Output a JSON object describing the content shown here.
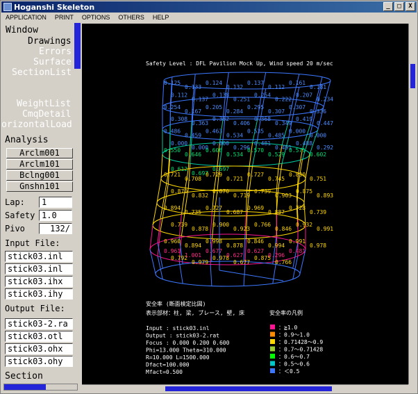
{
  "window": {
    "title": "Hoganshi Skeleton",
    "min": "_",
    "max": "□",
    "close": "X"
  },
  "menu": [
    "APPLICATION",
    "PRINT",
    "OPTIONS",
    "OTHERS",
    "HELP"
  ],
  "nav": {
    "window": "Window",
    "drawings": "Drawings",
    "errors": "Errors",
    "surface": "Surface",
    "sectionlist": "SectionList",
    "weightlist": "WeightList",
    "cmqdetail": "CmqDetail",
    "horizontalload": "orizontalLoad"
  },
  "analysis": {
    "label": "Analysis",
    "buttons": [
      "Arclm001",
      "Arclm101",
      "Bclng001",
      "Gnshn101"
    ]
  },
  "fields": {
    "lap_label": "Lap:",
    "lap": "1",
    "safety_label": "Safety",
    "safety": "1.0",
    "pivo_label": "Pivo",
    "pivo": "132/"
  },
  "input_files": {
    "label": "Input File:",
    "files": [
      "stick03.inl",
      "stick03.inl",
      "stick03.ihx",
      "stick03.ihy"
    ]
  },
  "output_files": {
    "label": "Output File:",
    "files": [
      "stick03-2.ra",
      "stick03.otl",
      "stick03.ohx",
      "stick03.ohy"
    ]
  },
  "section_label": "Section",
  "canvas": {
    "title": "Safety Level : DFL Pavilion Mock Up, Wind speed 20 m/sec",
    "caption1": "安全率 (断面検定比図)",
    "caption2": "表示部材：柱, 梁, ブレース, 壁, 床",
    "legend_title": "安全率の凡例",
    "info": [
      "Input  : stick03.inl",
      "Output : stick03-2.rat",
      "Focus : 0.000 0.200 0.600",
      "Phi=13.000 Theta=310.000",
      "R=10.000 L=1500.000",
      "Dfact=100.000",
      "Mfact=0.500"
    ],
    "legend": [
      {
        "label": "：≧1.0",
        "color": "#ff1493"
      },
      {
        "label": "：0.9～1.0",
        "color": "#ff8c00"
      },
      {
        "label": "：0.71428～0.9",
        "color": "#ffd700"
      },
      {
        "label": "：0.7～0.71428",
        "color": "#9acd32"
      },
      {
        "label": "：0.6～0.7",
        "color": "#00ff00"
      },
      {
        "label": "：0.5～0.6",
        "color": "#00c8c8"
      },
      {
        "label": "：＜0.5",
        "color": "#3c78ff"
      }
    ],
    "labels_blue": [
      "0.125",
      "0.133",
      "0.124",
      "0.132",
      "0.137",
      "0.112",
      "0.161",
      "0.181",
      "0.112",
      "0.137",
      "0.138",
      "0.251",
      "0.254",
      "0.222",
      "0.207",
      "0.234",
      "0.254",
      "0.167",
      "0.205",
      "0.284",
      "0.295",
      "0.307",
      "0.307",
      "0.336",
      "0.308",
      "0.363",
      "0.382",
      "0.406",
      "0.368",
      "0.349",
      "0.419",
      "0.447",
      "0.486",
      "0.459",
      "0.463",
      "0.534",
      "0.535",
      "0.485",
      "0.000",
      "0.000",
      "0.000",
      "0.000",
      "0.000",
      "0.296",
      "0.481",
      "0.491",
      "0.488",
      "0.292"
    ],
    "labels_green": [
      "0.550",
      "0.646",
      "0.606",
      "0.534",
      "0.570",
      "0.529",
      "0.571",
      "0.602",
      "0.612",
      "0.697",
      "0.697"
    ],
    "labels_yellow": [
      "0.721",
      "0.708",
      "0.729",
      "0.721",
      "0.727",
      "0.745",
      "0.830",
      "0.751",
      "0.870",
      "0.832",
      "0.870",
      "0.719",
      "0.739",
      "0.903",
      "0.875",
      "0.893",
      "0.894",
      "0.735",
      "0.727",
      "0.687",
      "0.969",
      "0.887",
      "0.728",
      "0.739",
      "0.739",
      "0.878",
      "0.900",
      "0.923",
      "0.766",
      "0.846",
      "0.932",
      "0.991",
      "0.960",
      "0.894",
      "0.998",
      "0.878",
      "0.846",
      "0.994",
      "0.991",
      "0.978",
      "0.792",
      "0.979",
      "0.978",
      "0.677",
      "0.875",
      "0.766"
    ],
    "labels_pink": [
      "0.961",
      "1.001",
      "0.677",
      "0.627",
      "0.627",
      "0.296",
      "0.481"
    ]
  }
}
